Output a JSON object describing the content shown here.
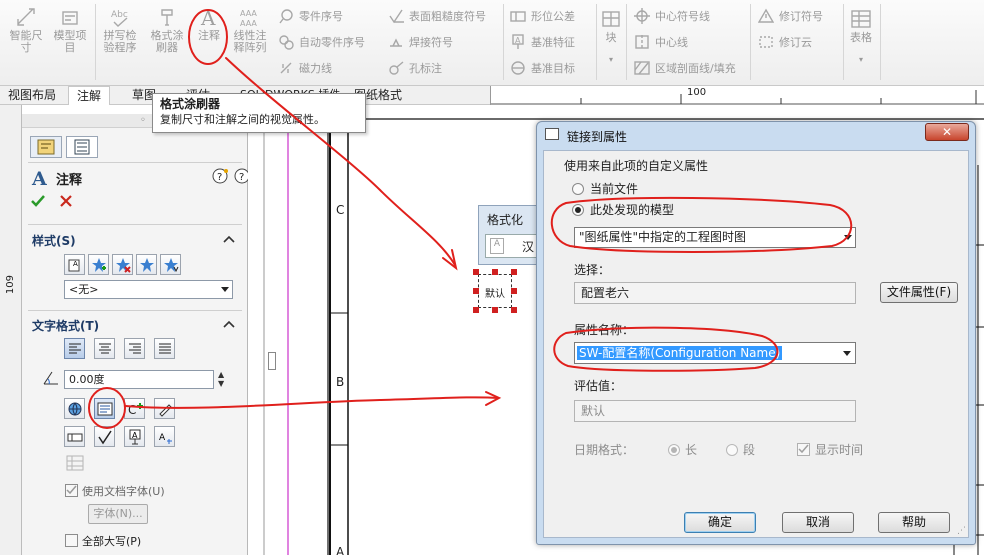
{
  "ribbon": {
    "big_buttons": [
      {
        "label": "智能尺\n寸",
        "icon": "smart-dimension-icon"
      },
      {
        "label": "模型项\n目",
        "icon": "model-items-icon"
      },
      {
        "label": "拼写检\n验程序",
        "icon": "spell-check-icon"
      },
      {
        "label": "格式涂\n刷器",
        "icon": "format-painter-icon"
      },
      {
        "label": "注释",
        "icon": "note-icon"
      },
      {
        "label": "线性注\n释阵列",
        "icon": "linear-note-pattern-icon"
      }
    ],
    "small_col1": [
      "零件序号",
      "自动零件序号",
      "磁力线"
    ],
    "small_col2": [
      "表面粗糙度符号",
      "焊接符号",
      "孔标注"
    ],
    "small_col3": [
      "形位公差",
      "基准特征",
      "基准目标"
    ],
    "block_label": "块",
    "small_col4": [
      "中心符号线",
      "中心线",
      "区域剖面线/填充"
    ],
    "small_col5": [
      "修订符号",
      "修订云"
    ],
    "table_label": "表格"
  },
  "tabs": [
    "视图布局",
    "注解",
    "草图",
    "评估",
    "SOLIDWORKS 插件",
    "图纸格式"
  ],
  "ruler": {
    "mark": "100"
  },
  "tooltip": {
    "title": "格式涂刷器",
    "description": "复制尺寸和注解之间的视觉属性。"
  },
  "panel": {
    "title": "注释",
    "style_section": "样式(S)",
    "style_value": "<无>",
    "text_format_section": "文字格式(T)",
    "angle_value": "0.00度",
    "use_doc_font": "使用文档字体(U)",
    "font_button": "字体(N)...",
    "all_caps": "全部大写(P)"
  },
  "drawing": {
    "zone_labels": [
      "C",
      "B",
      "A"
    ],
    "side_label": "109",
    "note_text": "默认"
  },
  "format_floater": {
    "title": "格式化",
    "font_sample": "汉"
  },
  "dialog": {
    "title": "链接到属性",
    "group_label": "使用来自此项的自定义属性",
    "option_current_file": "当前文件",
    "option_model_found": "此处发现的模型",
    "model_source": "\"图纸属性\"中指定的工程图时图",
    "selection_label": "选择：",
    "selection_value": "配置老六",
    "file_props_button": "文件属性(F)",
    "property_name_label": "属性名称：",
    "property_name_value": "SW-配置名称(Configuration Name)",
    "evaluated_label": "评估值：",
    "evaluated_value": "默认",
    "date_format_label": "日期格式：",
    "date_long": "长",
    "date_short": "段",
    "show_time": "显示时间",
    "ok": "确定",
    "cancel": "取消",
    "help": "帮助"
  },
  "colors": {
    "annotation_red": "#e0201c",
    "selection_blue": "#3399ff",
    "section_title": "#1e3b66"
  }
}
